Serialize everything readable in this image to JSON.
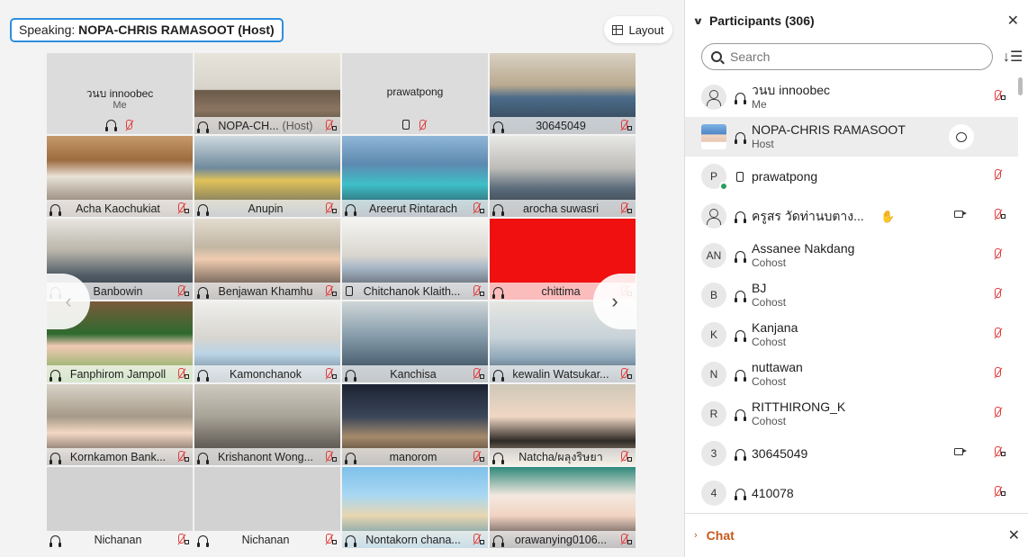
{
  "speaking": {
    "label": "Speaking:",
    "name": "NOPA-CHRIS RAMASOOT (Host)"
  },
  "layout_button": {
    "label": "Layout"
  },
  "colors": {
    "accent": "#1fa3ec",
    "muted_red": "#e03b3b",
    "chat_orange": "#c65a1e"
  },
  "video_tiles": [
    {
      "name": "วนบ innoobec",
      "sub": "Me",
      "type": "no-video"
    },
    {
      "name": "NOPA-CH...",
      "tag": "(Host)",
      "type": "video",
      "active": true
    },
    {
      "name": "prawatpong",
      "type": "no-video-phone"
    },
    {
      "name": "30645049",
      "type": "video"
    },
    {
      "name": "Acha Kaochukiat",
      "type": "video"
    },
    {
      "name": "Anupin",
      "type": "video"
    },
    {
      "name": "Areerut Rintarach",
      "type": "video"
    },
    {
      "name": "arocha suwasri",
      "type": "video"
    },
    {
      "name": "Banbowin",
      "type": "video"
    },
    {
      "name": "Benjawan Khamhu",
      "type": "video"
    },
    {
      "name": "Chitchanok Klaith...",
      "type": "video-phone"
    },
    {
      "name": "chittima",
      "type": "video-red"
    },
    {
      "name": "Fanphirom Jampoll",
      "type": "video"
    },
    {
      "name": "Kamonchanok",
      "type": "video"
    },
    {
      "name": "Kanchisa",
      "type": "video"
    },
    {
      "name": "kewalin Watsukar...",
      "type": "video"
    },
    {
      "name": "Kornkamon Bank...",
      "type": "video"
    },
    {
      "name": "Krishanont Wong...",
      "type": "video"
    },
    {
      "name": "manorom",
      "type": "video"
    },
    {
      "name": "Natcha/ผลุงริษยา",
      "type": "video"
    },
    {
      "name": "Nichanan",
      "type": "video"
    },
    {
      "name": "Nichanan",
      "type": "video"
    },
    {
      "name": "Nontakorn chana...",
      "type": "video"
    },
    {
      "name": "orawanying0106...",
      "type": "video"
    }
  ],
  "participants_panel": {
    "title": "Participants (306)",
    "search_placeholder": "Search",
    "chat_label": "Chat",
    "rows": [
      {
        "avatar": "person",
        "name": "วนบ innoobec",
        "role": "Me"
      },
      {
        "avatar": "photo",
        "name": "NOPA-CHRIS RAMASOOT",
        "role": "Host",
        "selected": true,
        "chat": true
      },
      {
        "avatar": "P",
        "name": "prawatpong",
        "role": "",
        "phone": true,
        "badge": true
      },
      {
        "avatar": "person",
        "name": "ครูสร วัดท่านบตาง...",
        "role": "",
        "hand": true,
        "camera": true
      },
      {
        "avatar": "AN",
        "name": "Assanee Nakdang",
        "role": "Cohost"
      },
      {
        "avatar": "B",
        "name": "BJ",
        "role": "Cohost"
      },
      {
        "avatar": "K",
        "name": "Kanjana",
        "role": "Cohost"
      },
      {
        "avatar": "N",
        "name": "nuttawan",
        "role": "Cohost"
      },
      {
        "avatar": "R",
        "name": "RITTHIRONG_K",
        "role": "Cohost"
      },
      {
        "avatar": "3",
        "name": "30645049",
        "role": "",
        "camera": true,
        "lock": true
      },
      {
        "avatar": "4",
        "name": "410078",
        "role": "",
        "lock": true
      }
    ]
  }
}
